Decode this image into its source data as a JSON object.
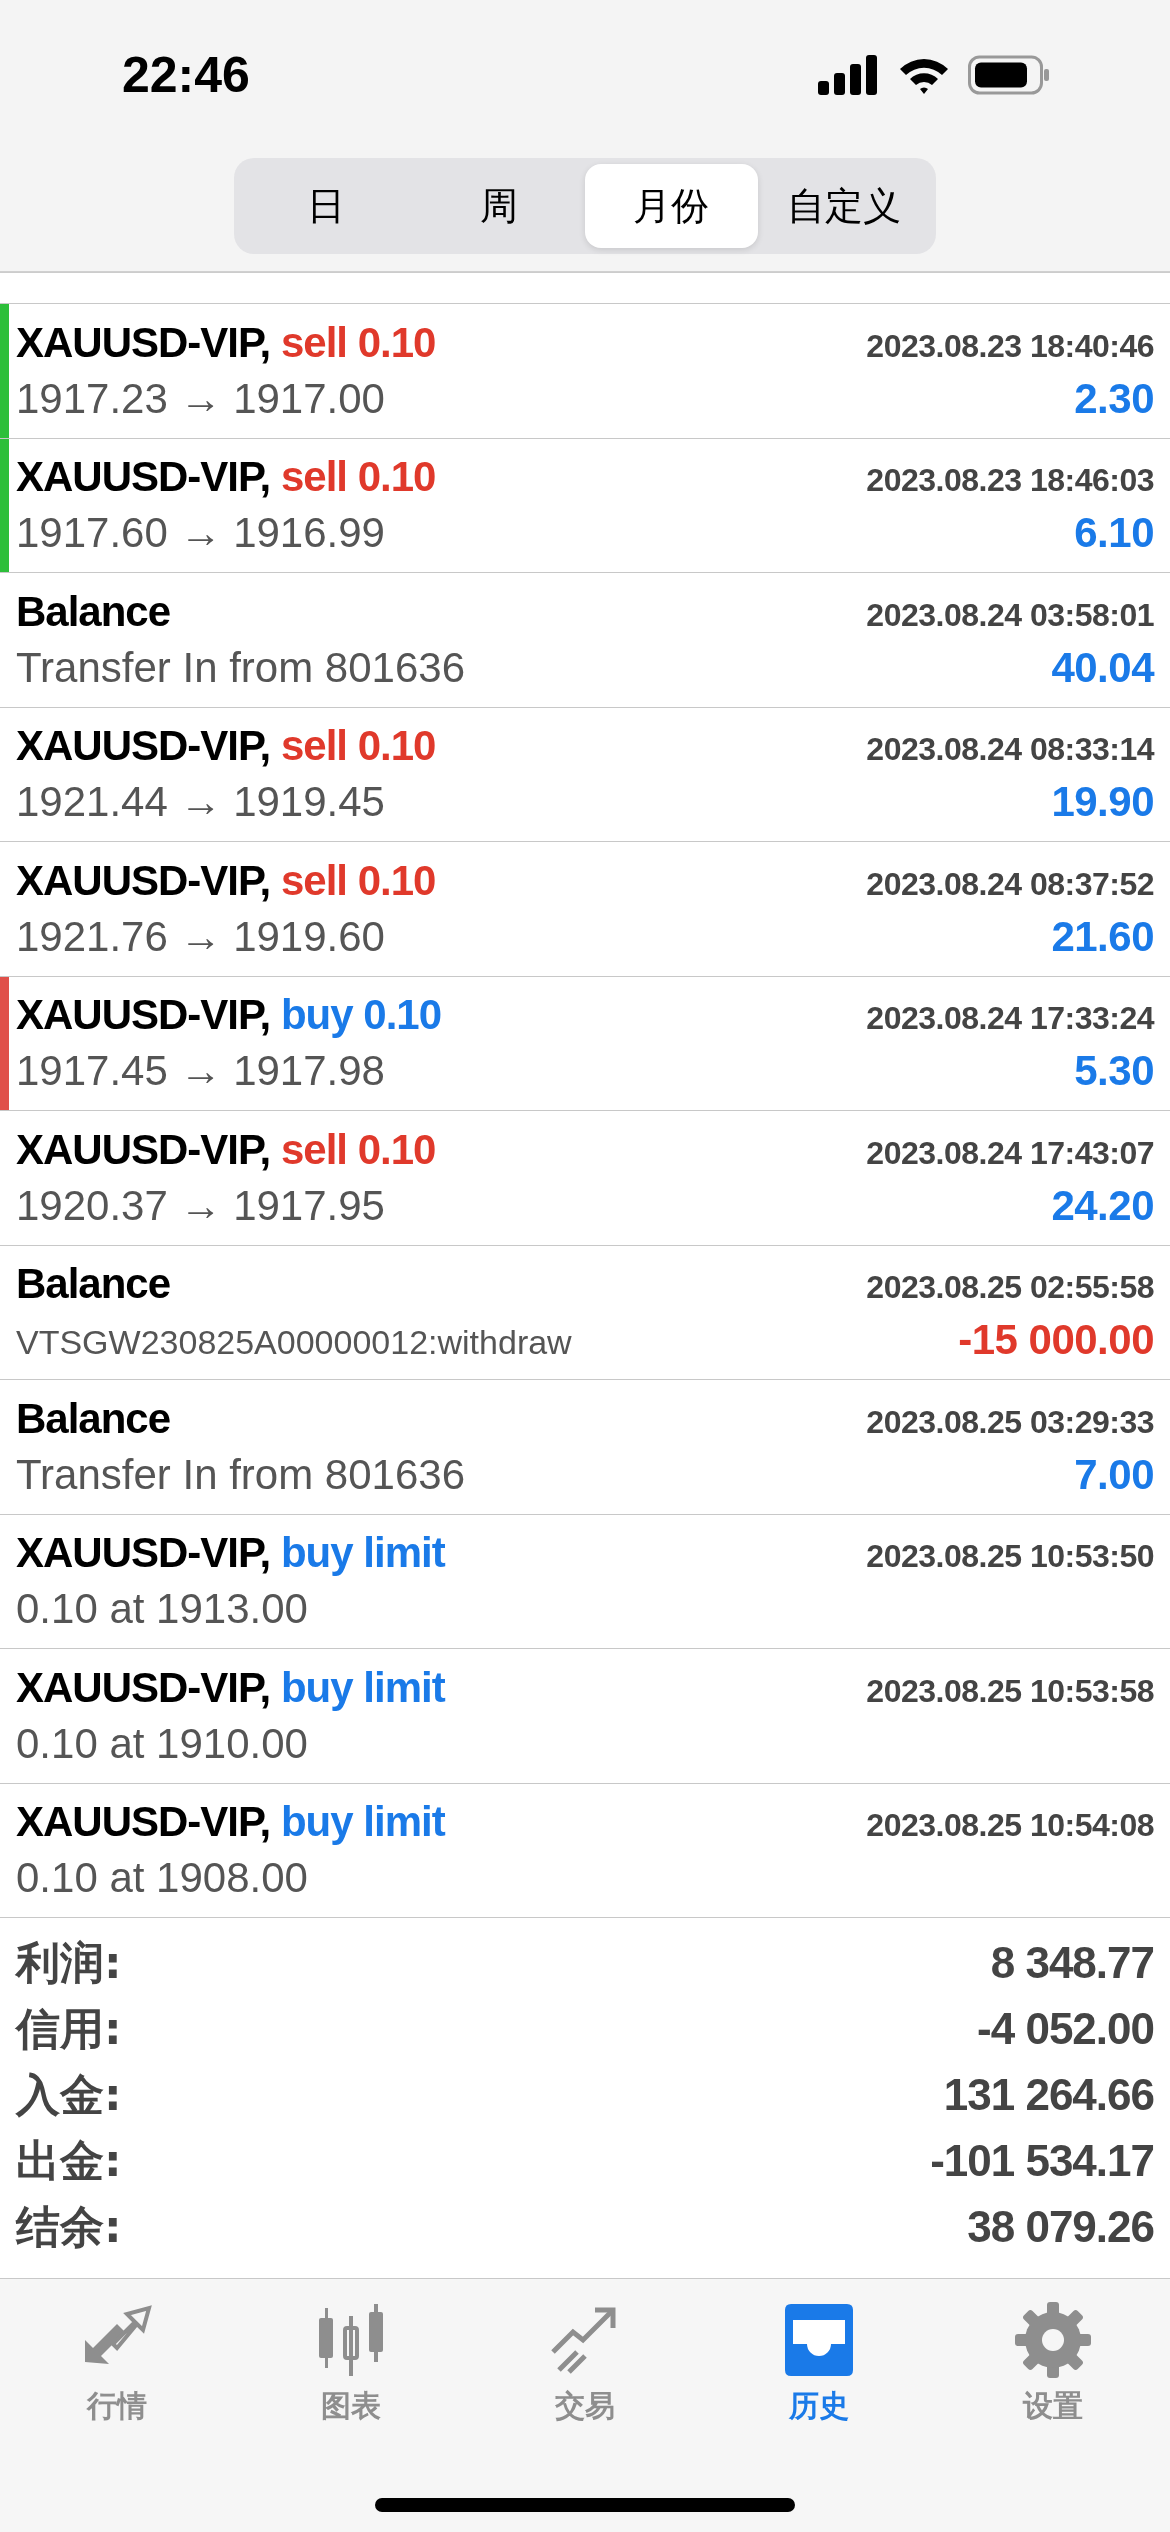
{
  "status_bar": {
    "time": "22:46"
  },
  "period_tabs": [
    {
      "label": "日",
      "selected": false
    },
    {
      "label": "周",
      "selected": false
    },
    {
      "label": "月份",
      "selected": true
    },
    {
      "label": "自定义",
      "selected": false
    }
  ],
  "deals": [
    {
      "kind": "sell",
      "symbol": "XAUUSD-VIP,",
      "action": "sell 0.10",
      "time": "2023.08.23 18:40:46",
      "detail": "1917.23 → 1917.00",
      "amount": "2.30",
      "loss": false,
      "color": "#2dbf3a"
    },
    {
      "kind": "sell",
      "symbol": "XAUUSD-VIP,",
      "action": "sell 0.10",
      "time": "2023.08.23 18:46:03",
      "detail": "1917.60 → 1916.99",
      "amount": "6.10",
      "loss": false,
      "color": "#2dbf3a"
    },
    {
      "kind": "balance",
      "symbol": "Balance",
      "time": "2023.08.24 03:58:01",
      "detail": "Transfer In from 801636",
      "amount": "40.04",
      "loss": false
    },
    {
      "kind": "sell",
      "symbol": "XAUUSD-VIP,",
      "action": "sell 0.10",
      "time": "2023.08.24 08:33:14",
      "detail": "1921.44 → 1919.45",
      "amount": "19.90",
      "loss": false
    },
    {
      "kind": "sell",
      "symbol": "XAUUSD-VIP,",
      "action": "sell 0.10",
      "time": "2023.08.24 08:37:52",
      "detail": "1921.76 → 1919.60",
      "amount": "21.60",
      "loss": false
    },
    {
      "kind": "buy",
      "symbol": "XAUUSD-VIP,",
      "action": "buy 0.10",
      "time": "2023.08.24 17:33:24",
      "detail": "1917.45 → 1917.98",
      "amount": "5.30",
      "loss": false,
      "color": "#e0504a"
    },
    {
      "kind": "sell",
      "symbol": "XAUUSD-VIP,",
      "action": "sell 0.10",
      "time": "2023.08.24 17:43:07",
      "detail": "1920.37 → 1917.95",
      "amount": "24.20",
      "loss": false
    },
    {
      "kind": "balance",
      "symbol": "Balance",
      "time": "2023.08.25 02:55:58",
      "detail": "VTSGW230825A00000012:withdraw",
      "amount": "-15 000.00",
      "loss": true
    },
    {
      "kind": "balance",
      "symbol": "Balance",
      "time": "2023.08.25 03:29:33",
      "detail": "Transfer In from 801636",
      "amount": "7.00",
      "loss": false
    },
    {
      "kind": "buy",
      "symbol": "XAUUSD-VIP,",
      "action": "buy limit",
      "time": "2023.08.25 10:53:50",
      "detail": "0.10 at 1913.00"
    },
    {
      "kind": "buy",
      "symbol": "XAUUSD-VIP,",
      "action": "buy limit",
      "time": "2023.08.25 10:53:58",
      "detail": "0.10 at 1910.00"
    },
    {
      "kind": "buy",
      "symbol": "XAUUSD-VIP,",
      "action": "buy limit",
      "time": "2023.08.25 10:54:08",
      "detail": "0.10 at 1908.00"
    }
  ],
  "summary": [
    {
      "label": "利润:",
      "value": "8 348.77"
    },
    {
      "label": "信用:",
      "value": "-4 052.00"
    },
    {
      "label": "入金:",
      "value": "131 264.66"
    },
    {
      "label": "出金:",
      "value": "-101 534.17"
    },
    {
      "label": "结余:",
      "value": "38 079.26"
    }
  ],
  "tab_bar": [
    {
      "label": "行情",
      "selected": false
    },
    {
      "label": "图表",
      "selected": false
    },
    {
      "label": "交易",
      "selected": false
    },
    {
      "label": "历史",
      "selected": true
    },
    {
      "label": "设置",
      "selected": false
    }
  ]
}
